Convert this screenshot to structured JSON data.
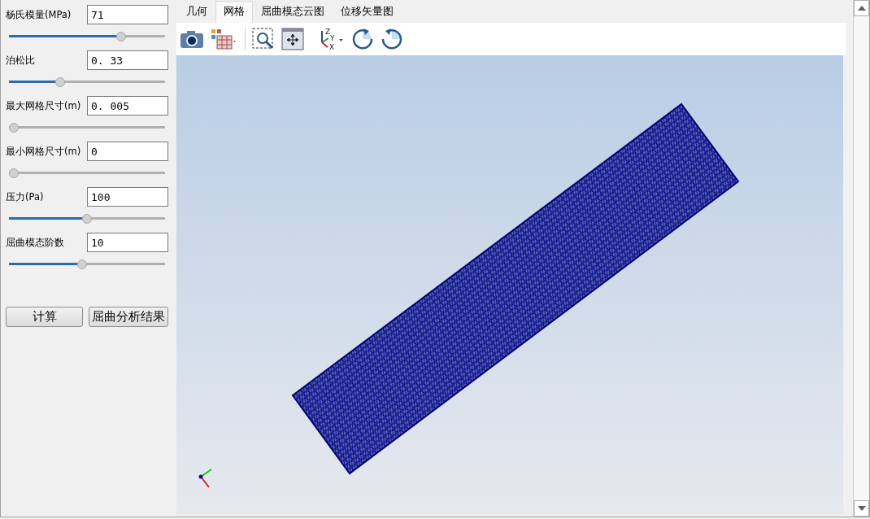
{
  "parameters": [
    {
      "label": "杨氏模量(MPa)",
      "value": "71",
      "level": 0.72
    },
    {
      "label": "泊松比",
      "value": "0. 33",
      "level": 0.33
    },
    {
      "label": "最大网格尺寸(m)",
      "value": "0. 005",
      "level": 0
    },
    {
      "label": "最小网格尺寸(m)",
      "value": "0",
      "level": 0
    },
    {
      "label": "压力(Pa)",
      "value": "100",
      "level": 0.5
    },
    {
      "label": "屈曲模态阶数",
      "value": "10",
      "level": 0.47
    }
  ],
  "buttons": [
    "计算",
    "屈曲分析结果"
  ],
  "tabs": [
    {
      "label": "几何",
      "selected": false
    },
    {
      "label": "网格",
      "selected": true
    },
    {
      "label": "屈曲模态云图",
      "selected": false
    },
    {
      "label": "位移矢量图",
      "selected": false
    }
  ],
  "axis_labels": [
    "Z",
    "Y",
    "X"
  ]
}
